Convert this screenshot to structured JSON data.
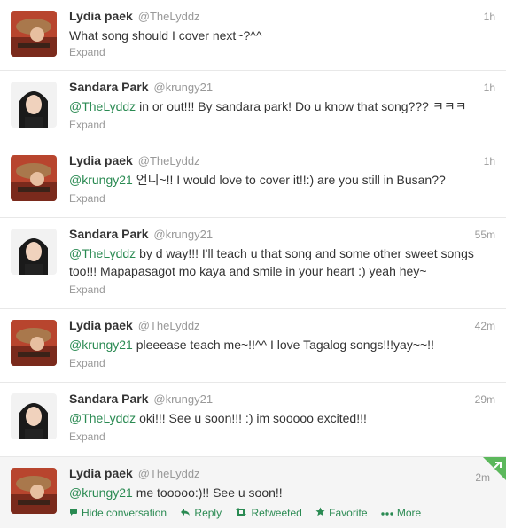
{
  "colors": {
    "link": "#2a8a52",
    "muted": "#999999",
    "badge": "#5cb85c"
  },
  "tweets": [
    {
      "fullname": "Lydia paek",
      "username": "@TheLyddz",
      "time": "1h",
      "mention": "",
      "text": "What song should I cover next~?^^",
      "expand": "Expand",
      "avatar": "lydia"
    },
    {
      "fullname": "Sandara Park",
      "username": "@krungy21",
      "time": "1h",
      "mention": "@TheLyddz",
      "text": " in or out!!! By sandara park! Do u know that song??? ㅋㅋㅋ",
      "expand": "Expand",
      "avatar": "sandara"
    },
    {
      "fullname": "Lydia paek",
      "username": "@TheLyddz",
      "time": "1h",
      "mention": "@krungy21",
      "text": " 언니~!! I would love to cover it!!:) are you still in Busan??",
      "expand": "Expand",
      "avatar": "lydia"
    },
    {
      "fullname": "Sandara Park",
      "username": "@krungy21",
      "time": "55m",
      "mention": "@TheLyddz",
      "text": " by d way!!! I'll teach u that song and some other sweet songs too!!! Mapapasagot mo kaya and smile in your heart :) yeah hey~",
      "expand": "Expand",
      "avatar": "sandara"
    },
    {
      "fullname": "Lydia paek",
      "username": "@TheLyddz",
      "time": "42m",
      "mention": "@krungy21",
      "text": " pleeease teach me~!!^^ I love Tagalog songs!!!yay~~!!",
      "expand": "Expand",
      "avatar": "lydia"
    },
    {
      "fullname": "Sandara Park",
      "username": "@krungy21",
      "time": "29m",
      "mention": "@TheLyddz",
      "text": " oki!!! See u soon!!! :) im sooooo excited!!!",
      "expand": "Expand",
      "avatar": "sandara"
    },
    {
      "fullname": "Lydia paek",
      "username": "@TheLyddz",
      "time": "2m",
      "mention": "@krungy21",
      "text": " me tooooo:)!! See u soon!!",
      "expand": "",
      "avatar": "lydia"
    }
  ],
  "actions": {
    "hide_conversation": {
      "label": "Hide conversation",
      "icon": "conversation-icon"
    },
    "reply": {
      "label": "Reply",
      "icon": "reply-icon"
    },
    "retweeted": {
      "label": "Retweeted",
      "icon": "retweet-icon"
    },
    "favorite": {
      "label": "Favorite",
      "icon": "star-icon"
    },
    "more": {
      "label": "More",
      "icon": "more-icon"
    }
  }
}
